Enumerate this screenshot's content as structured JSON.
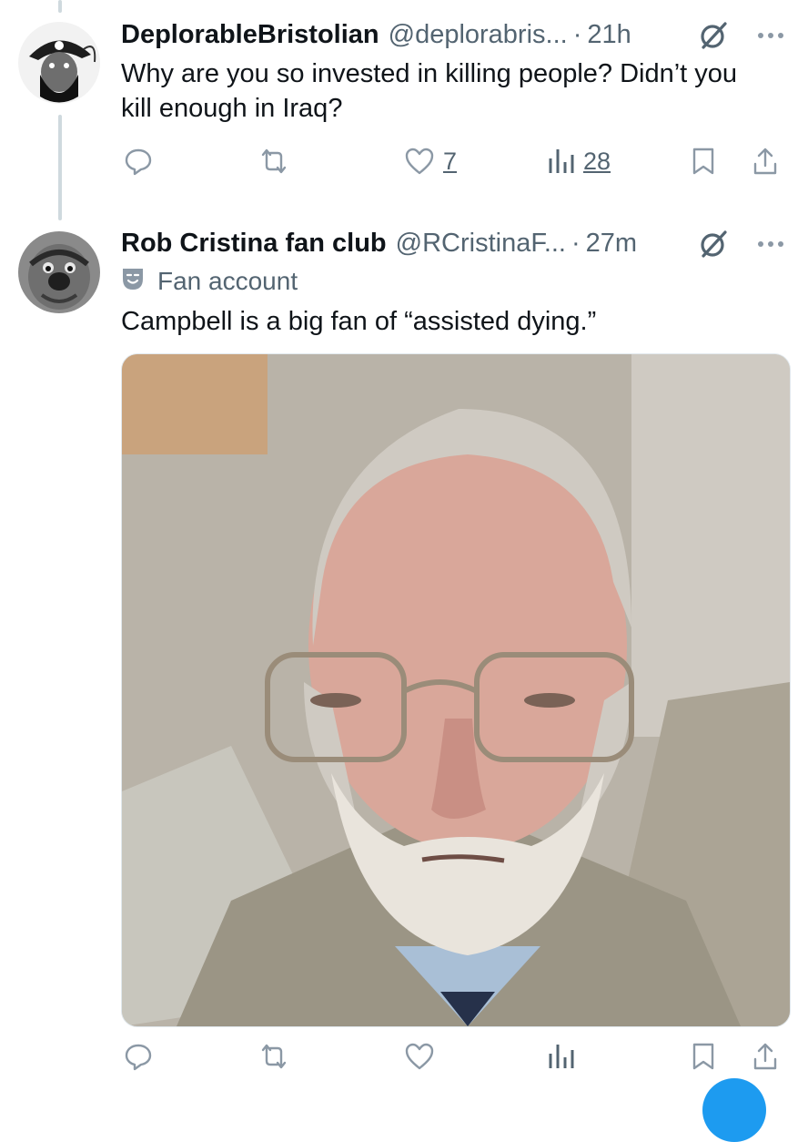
{
  "tweets": [
    {
      "author_name": "DeplorableBristolian",
      "author_handle": "@deplorabris...",
      "separator": "·",
      "time": "21h",
      "text": "Why are you so invested in killing people? Didn’t you kill enough in Iraq?",
      "stats": {
        "replies": "",
        "retweets": "",
        "likes": "7",
        "views": "28"
      }
    },
    {
      "author_name": "Rob Cristina fan club",
      "author_handle": "@RCristinaF...",
      "separator": "·",
      "time": "27m",
      "badge_label": "Fan account",
      "text": "Campbell is a big fan of “assisted dying.”",
      "stats": {
        "replies": "",
        "retweets": "",
        "likes": "",
        "views": ""
      }
    }
  ],
  "icons": [
    "grok-icon",
    "more-icon",
    "reply-icon",
    "retweet-icon",
    "like-icon",
    "views-icon",
    "bookmark-icon",
    "share-icon",
    "theater-mask-icon"
  ],
  "colors": {
    "text": "#0f1419",
    "secondary": "#536471",
    "icon": "#8b98a5",
    "thread_line": "#cfd9de",
    "accent": "#1d9bf0"
  }
}
